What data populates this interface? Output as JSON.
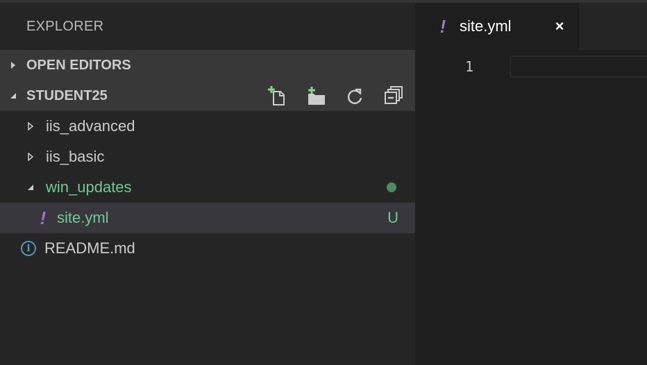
{
  "sidebar": {
    "title": "EXPLORER",
    "open_editors": {
      "label": "OPEN EDITORS",
      "expanded": false
    },
    "workspace": {
      "label": "STUDENT25",
      "expanded": true,
      "actions": [
        {
          "name": "new-file-icon"
        },
        {
          "name": "new-folder-icon"
        },
        {
          "name": "refresh-icon"
        },
        {
          "name": "collapse-all-icon"
        }
      ]
    },
    "tree": [
      {
        "name": "iis_advanced",
        "type": "folder",
        "expanded": false
      },
      {
        "name": "iis_basic",
        "type": "folder",
        "expanded": false
      },
      {
        "name": "win_updates",
        "type": "folder",
        "expanded": true,
        "modified": true
      },
      {
        "name": "site.yml",
        "type": "file",
        "icon": "yaml-icon",
        "status": "U",
        "selected": true
      },
      {
        "name": "README.md",
        "type": "file",
        "icon": "info-icon"
      }
    ],
    "icons": {
      "yaml_glyph": "!",
      "info_glyph": "i"
    }
  },
  "editor": {
    "tabs": [
      {
        "label": "site.yml",
        "icon_glyph": "!",
        "close_glyph": "×",
        "active": true
      }
    ],
    "line_numbers": [
      "1"
    ]
  },
  "colors": {
    "modified_green": "#73c991",
    "yaml_purple": "#a074c4",
    "info_blue": "#519aba",
    "sidebar_bg": "#252526",
    "editor_bg": "#1e1e1e"
  }
}
